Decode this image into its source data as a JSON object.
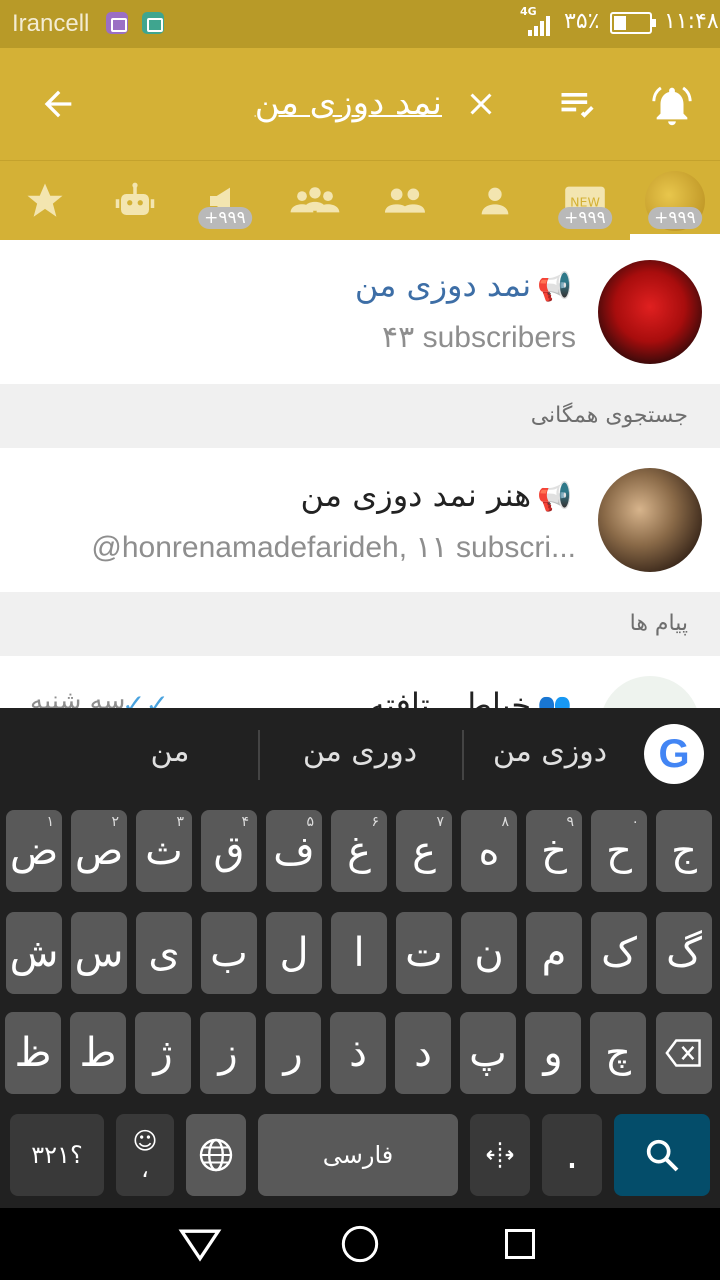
{
  "status_bar": {
    "carrier": "Irancell",
    "network": "4G",
    "battery": "۳۵٪",
    "time": "۱۱:۴۸"
  },
  "app_bar": {
    "search_query": "نمد دوزی من",
    "icons": [
      "back-arrow-icon",
      "close-icon",
      "mark-read-icon",
      "bell-icon"
    ]
  },
  "tabs": [
    {
      "name": "all-chats",
      "badge": "+۹۹۹"
    },
    {
      "name": "unread",
      "badge": "+۹۹۹"
    },
    {
      "name": "contacts"
    },
    {
      "name": "groups"
    },
    {
      "name": "supergroups"
    },
    {
      "name": "channels",
      "badge": "+۹۹۹"
    },
    {
      "name": "bots"
    },
    {
      "name": "favorites"
    }
  ],
  "results": {
    "channel_1": {
      "title": "نمد دوزی من",
      "subtitle": "۴۳ subscribers"
    },
    "global_header": "جستجوی همگانی",
    "channel_2": {
      "title": "هنر نمد دوزی من",
      "subtitle": "@honrenamadefarideh, ۱۱ subscri..."
    },
    "messages_header": "پیام ها",
    "message_1": {
      "title": "خیاطی تافته",
      "date": "سه شنبه"
    }
  },
  "keyboard": {
    "suggestions": [
      "دوزی من",
      "دوری من",
      "من"
    ],
    "row1": [
      {
        "label": "ج",
        "hint": ""
      },
      {
        "label": "ح",
        "hint": "۰"
      },
      {
        "label": "خ",
        "hint": "۹"
      },
      {
        "label": "ه",
        "hint": "۸"
      },
      {
        "label": "ع",
        "hint": "۷"
      },
      {
        "label": "غ",
        "hint": "۶"
      },
      {
        "label": "ف",
        "hint": "۵"
      },
      {
        "label": "ق",
        "hint": "۴"
      },
      {
        "label": "ث",
        "hint": "۳"
      },
      {
        "label": "ص",
        "hint": "۲"
      },
      {
        "label": "ض",
        "hint": "۱"
      }
    ],
    "row2": [
      "گ",
      "ک",
      "م",
      "ن",
      "ت",
      "ا",
      "ل",
      "ب",
      "ی",
      "س",
      "ش"
    ],
    "row3": [
      "چ",
      "و",
      "پ",
      "د",
      "ذ",
      "ر",
      "ز",
      "ژ",
      "ط",
      "ظ"
    ],
    "symbols_label": "؟۳۲۱",
    "comma_label": "،",
    "space_label": "فارسی",
    "period_label": "."
  },
  "colors": {
    "app_bar": "#d4b136",
    "status_bar": "#b89a28",
    "channel_title_blue": "#3d6ea6",
    "keyboard_bg": "#212121",
    "key_bg": "#595959",
    "search_key": "#044d6a"
  }
}
